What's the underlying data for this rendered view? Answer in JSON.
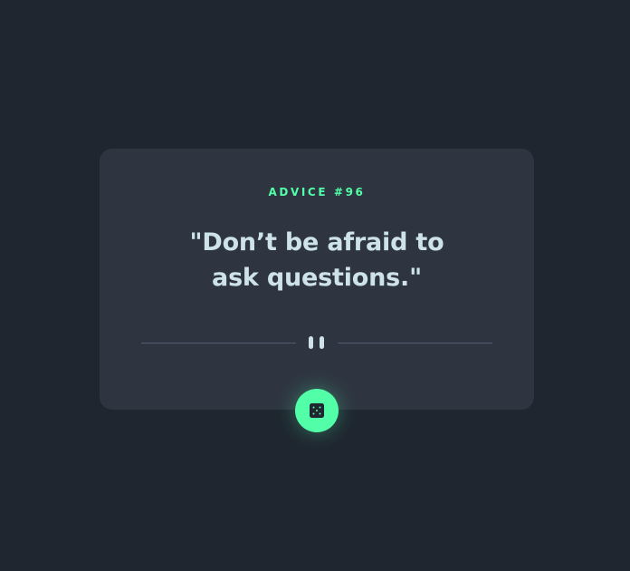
{
  "card": {
    "advice_label": "ADVICE #96",
    "quote": "\"Don’t be afraid to ask questions.\""
  },
  "divider": {
    "icon": "pause-icon"
  },
  "button": {
    "icon": "dice-icon",
    "accent_color": "#52ffa8"
  },
  "colors": {
    "background": "#1f2630",
    "card": "#2e3541",
    "accent": "#52ffa8",
    "text": "#cee3e9",
    "divider": "#4f5d74"
  }
}
